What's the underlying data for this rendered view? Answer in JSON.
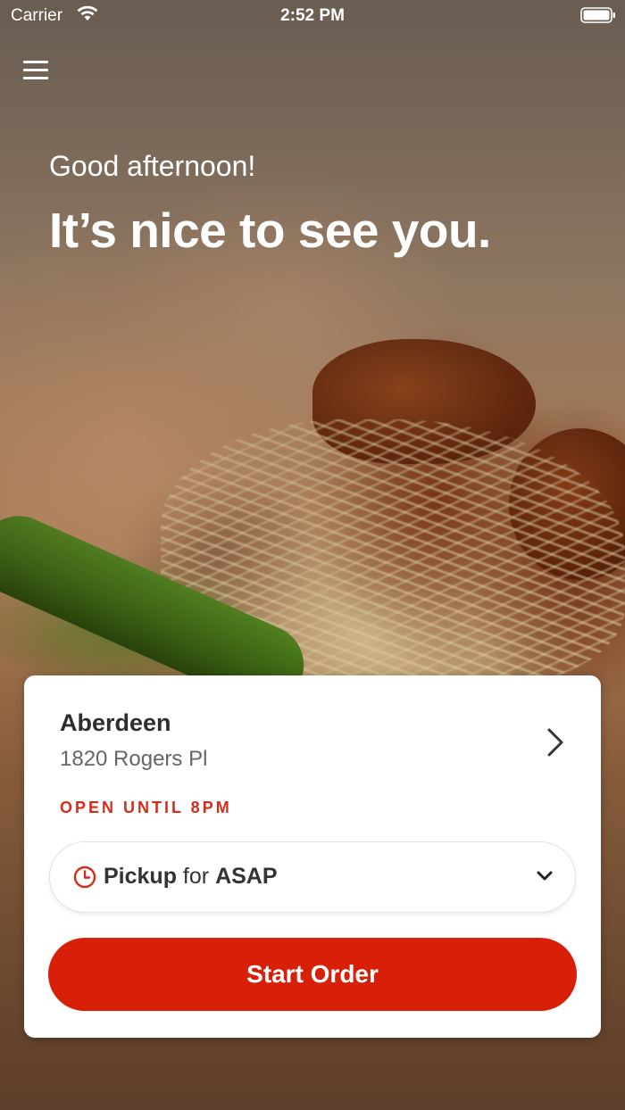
{
  "status_bar": {
    "carrier": "Carrier",
    "time": "2:52 PM",
    "wifi_icon": "wifi-icon",
    "battery_icon": "battery-icon"
  },
  "header": {
    "menu_icon": "hamburger-menu-icon"
  },
  "hero": {
    "greeting": "Good afternoon!",
    "headline": "It’s nice to see you."
  },
  "location_card": {
    "name": "Aberdeen",
    "address": "1820 Rogers Pl",
    "open_status": "OPEN UNTIL 8PM",
    "chevron_icon": "chevron-right-icon",
    "order_type": {
      "icon": "clock-icon",
      "method": "Pickup",
      "connector": " for ",
      "time": "ASAP",
      "dropdown_icon": "chevron-down-icon"
    },
    "start_order_label": "Start Order"
  },
  "colors": {
    "accent_red": "#d81f07",
    "status_red": "#d62c1a",
    "card_bg": "#ffffff",
    "text_dark": "#2e2e2e",
    "text_muted": "#666666"
  }
}
